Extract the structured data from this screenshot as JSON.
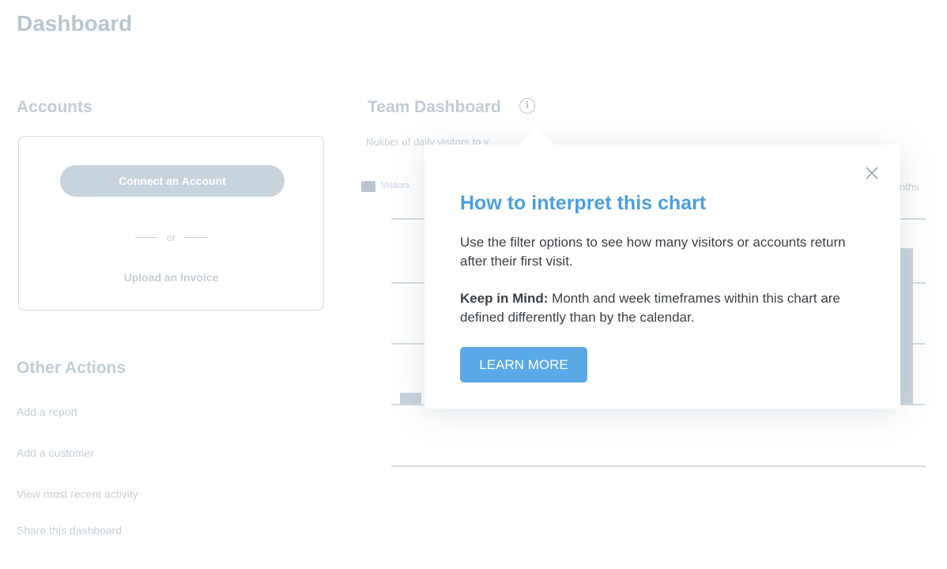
{
  "page": {
    "title": "Dashboard"
  },
  "accounts": {
    "title": "Accounts",
    "connect_label": "Connect an Account",
    "or_label": "or",
    "upload_label": "Upload an Invoice"
  },
  "other_actions": {
    "title": "Other Actions",
    "items": [
      {
        "label": "Add a report"
      },
      {
        "label": "Add a customer"
      },
      {
        "label": "View most recent activity"
      },
      {
        "label": "Share this dashboard"
      }
    ]
  },
  "team_dashboard": {
    "title": "Team Dashboard",
    "info_icon": "info-icon",
    "subtitle": "Nukber of daily visitors to y",
    "legend_label": "Visitors",
    "filter_label": "nths"
  },
  "popover": {
    "title": "How to interpret this chart",
    "body": "Use the filter options to see how many visitors or accounts return after their first visit.",
    "note_label": "Keep in Mind:",
    "note_text": " Month and week timeframes within this chart are defined differently than by the calendar.",
    "button_label": "LEARN MORE",
    "close_icon": "close-icon"
  },
  "colors": {
    "accent": "#4b9ee0",
    "button": "#5aa9e6",
    "muted": "#c5ced6"
  }
}
